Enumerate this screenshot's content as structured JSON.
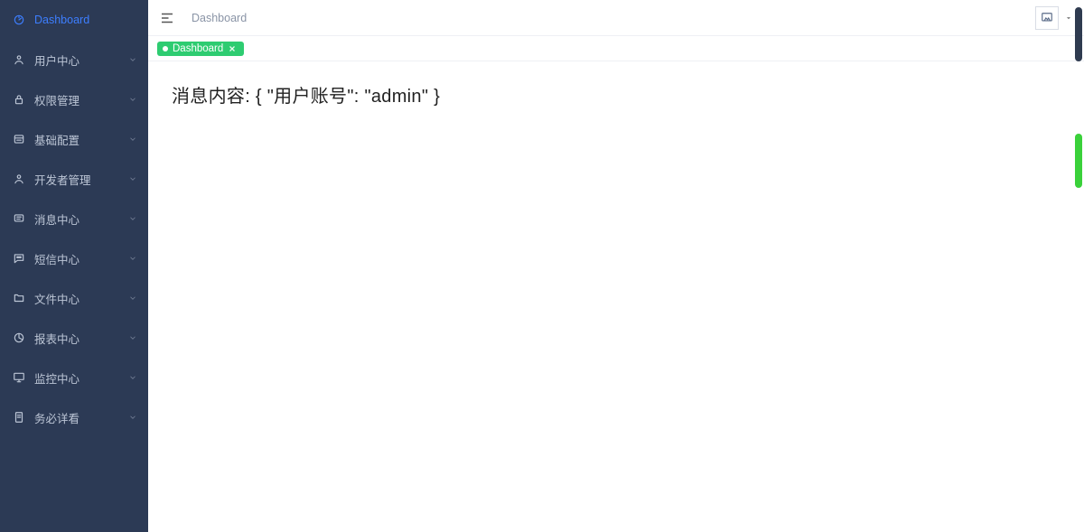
{
  "header": {
    "breadcrumb": "Dashboard"
  },
  "sidebar": {
    "items": [
      {
        "label": "Dashboard",
        "icon": "dashboard-icon",
        "active": true,
        "expandable": false
      },
      {
        "label": "用户中心",
        "icon": "user-icon",
        "active": false,
        "expandable": true
      },
      {
        "label": "权限管理",
        "icon": "lock-icon",
        "active": false,
        "expandable": true
      },
      {
        "label": "基础配置",
        "icon": "settings-card-icon",
        "active": false,
        "expandable": true
      },
      {
        "label": "开发者管理",
        "icon": "developer-icon",
        "active": false,
        "expandable": true
      },
      {
        "label": "消息中心",
        "icon": "message-icon",
        "active": false,
        "expandable": true
      },
      {
        "label": "短信中心",
        "icon": "sms-icon",
        "active": false,
        "expandable": true
      },
      {
        "label": "文件中心",
        "icon": "folder-icon",
        "active": false,
        "expandable": true
      },
      {
        "label": "报表中心",
        "icon": "report-icon",
        "active": false,
        "expandable": true
      },
      {
        "label": "监控中心",
        "icon": "monitor-icon",
        "active": false,
        "expandable": true
      },
      {
        "label": "务必详看",
        "icon": "document-icon",
        "active": false,
        "expandable": true
      }
    ]
  },
  "tabs": [
    {
      "label": "Dashboard",
      "active": true
    }
  ],
  "content": {
    "message": "消息内容: { \"用户账号\": \"admin\" }"
  }
}
